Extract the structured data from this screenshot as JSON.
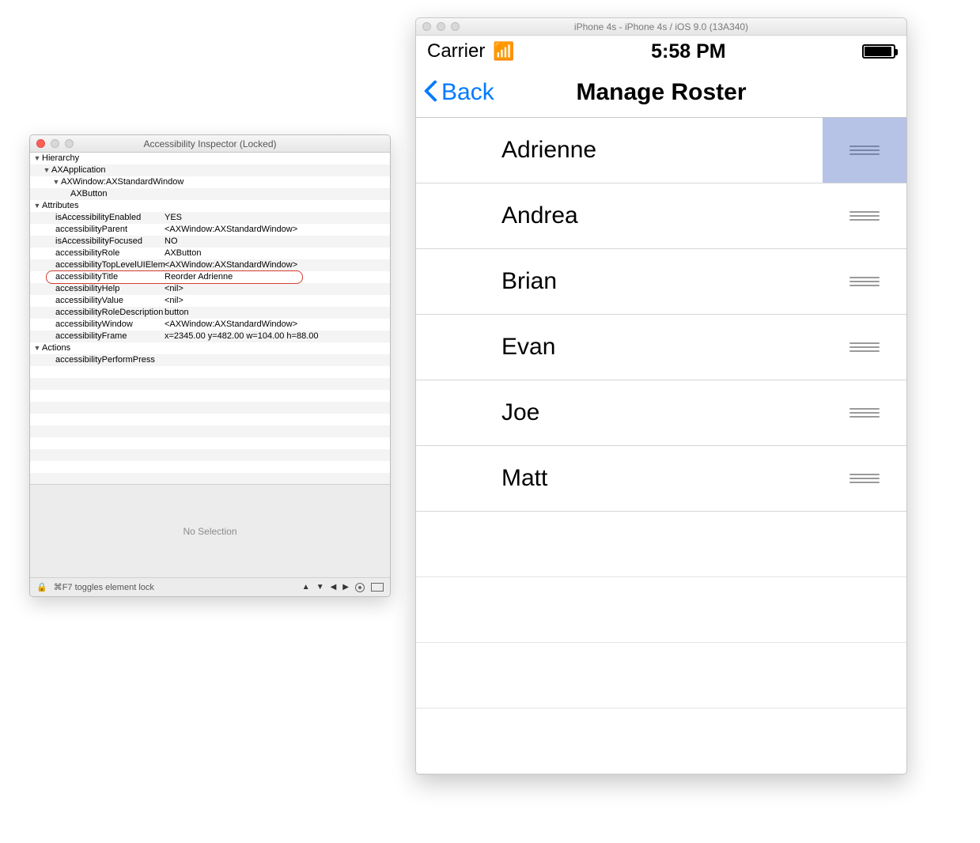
{
  "inspector": {
    "window_title": "Accessibility Inspector (Locked)",
    "sections": {
      "hierarchy_label": "Hierarchy",
      "attributes_label": "Attributes",
      "actions_label": "Actions"
    },
    "hierarchy": [
      {
        "indent": 1,
        "label": "AXApplication",
        "disclosure": true
      },
      {
        "indent": 2,
        "label": "AXWindow:AXStandardWindow",
        "disclosure": true
      },
      {
        "indent": 3,
        "label": "AXButton",
        "disclosure": false
      }
    ],
    "attributes": [
      {
        "key": "isAccessibilityEnabled",
        "val": "YES"
      },
      {
        "key": "accessibilityParent",
        "val": "<AXWindow:AXStandardWindow>"
      },
      {
        "key": "isAccessibilityFocused",
        "val": "NO"
      },
      {
        "key": "accessibilityRole",
        "val": "AXButton"
      },
      {
        "key": "accessibilityTopLevelUIElement",
        "val": "<AXWindow:AXStandardWindow>"
      },
      {
        "key": "accessibilityTitle",
        "val": "Reorder Adrienne",
        "circled": true
      },
      {
        "key": "accessibilityHelp",
        "val": "<nil>"
      },
      {
        "key": "accessibilityValue",
        "val": "<nil>"
      },
      {
        "key": "accessibilityRoleDescription",
        "val": "button"
      },
      {
        "key": "accessibilityWindow",
        "val": "<AXWindow:AXStandardWindow>"
      },
      {
        "key": "accessibilityFrame",
        "val": "x=2345.00 y=482.00 w=104.00 h=88.00"
      }
    ],
    "actions": [
      {
        "key": "accessibilityPerformPress"
      }
    ],
    "no_selection": "No Selection",
    "footer_hint": "⌘F7 toggles element lock"
  },
  "simulator": {
    "window_title": "iPhone 4s - iPhone 4s / iOS 9.0 (13A340)",
    "status": {
      "carrier": "Carrier",
      "time": "5:58 PM"
    },
    "nav": {
      "back_label": "Back",
      "title": "Manage Roster"
    },
    "roster": [
      {
        "name": "Adrienne",
        "selected": true
      },
      {
        "name": "Andrea",
        "selected": false
      },
      {
        "name": "Brian",
        "selected": false
      },
      {
        "name": "Evan",
        "selected": false
      },
      {
        "name": "Joe",
        "selected": false
      },
      {
        "name": "Matt",
        "selected": false
      }
    ],
    "empty_rows": 4
  }
}
